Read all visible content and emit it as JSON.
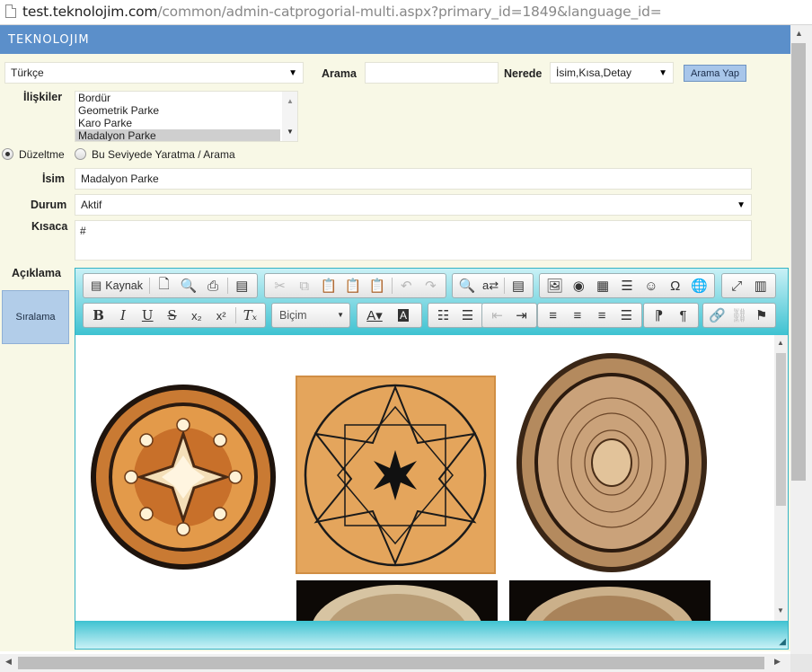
{
  "address_bar": {
    "host": "test.teknolojim.com",
    "path": "/common/admin-catprogorial-multi.aspx?primary_id=1849&language_id="
  },
  "header": {
    "logo": "TEKNOLOJIM"
  },
  "search": {
    "language_value": "Türkçe",
    "arama_label": "Arama",
    "arama_value": "",
    "nerede_label": "Nerede",
    "nerede_value": "İsim,Kısa,Detay",
    "button_label": "Arama Yap"
  },
  "relations": {
    "label": "İlişkiler",
    "items": [
      "Bordür",
      "Geometrik Parke",
      "Karo Parke",
      "Madalyon Parke"
    ],
    "selected_index": 3
  },
  "mode": {
    "edit_label": "Düzeltme",
    "create_label": "Bu Seviyede Yaratma / Arama",
    "selected": "edit"
  },
  "form": {
    "isim_label": "İsim",
    "isim_value": "Madalyon Parke",
    "durum_label": "Durum",
    "durum_value": "Aktif",
    "kisaca_label": "Kısaca",
    "kisaca_value": "#",
    "aciklama_label": "Açıklama",
    "siralama_label": "Sıralama"
  },
  "editor": {
    "source_label": "Kaynak",
    "format_combo": "Biçim",
    "images": [
      "medallion-star",
      "geometric-star-parquet",
      "rosette-medallion",
      "medallion-partial-1",
      "medallion-partial-2"
    ]
  }
}
